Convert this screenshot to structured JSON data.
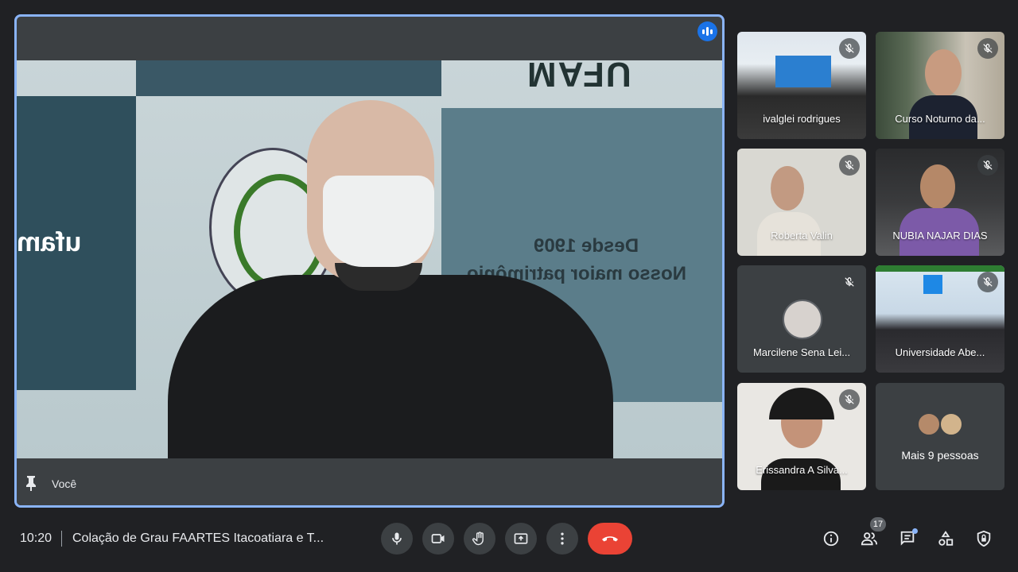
{
  "main_tile": {
    "speaker_label": "Você",
    "backdrop": {
      "top_text": "UFAM",
      "line1": "Desde 1909",
      "line2": "Nosso maior patrimônio",
      "left_text": "ufam"
    }
  },
  "participants": [
    {
      "name": "ivalglei rodrigues",
      "muted": true
    },
    {
      "name": "Curso Noturno da...",
      "muted": true
    },
    {
      "name": "Roberta Valin",
      "muted": true
    },
    {
      "name": "NUBIA NAJAR DIAS",
      "muted": true
    },
    {
      "name": "Marcilene Sena Lei...",
      "muted": true
    },
    {
      "name": "Universidade Abe...",
      "muted": true
    },
    {
      "name": "Erissandra A Silva...",
      "muted": true
    }
  ],
  "more_tile": {
    "label": "Mais 9 pessoas"
  },
  "bottom_bar": {
    "time": "10:20",
    "meeting_title": "Colação de Grau FAARTES Itacoatiara e T...",
    "participant_count": "17"
  },
  "colors": {
    "background": "#202124",
    "tile": "#3c4043",
    "active_border": "#8ab4f8",
    "end_call": "#ea4335",
    "speaking": "#1a73e8"
  }
}
